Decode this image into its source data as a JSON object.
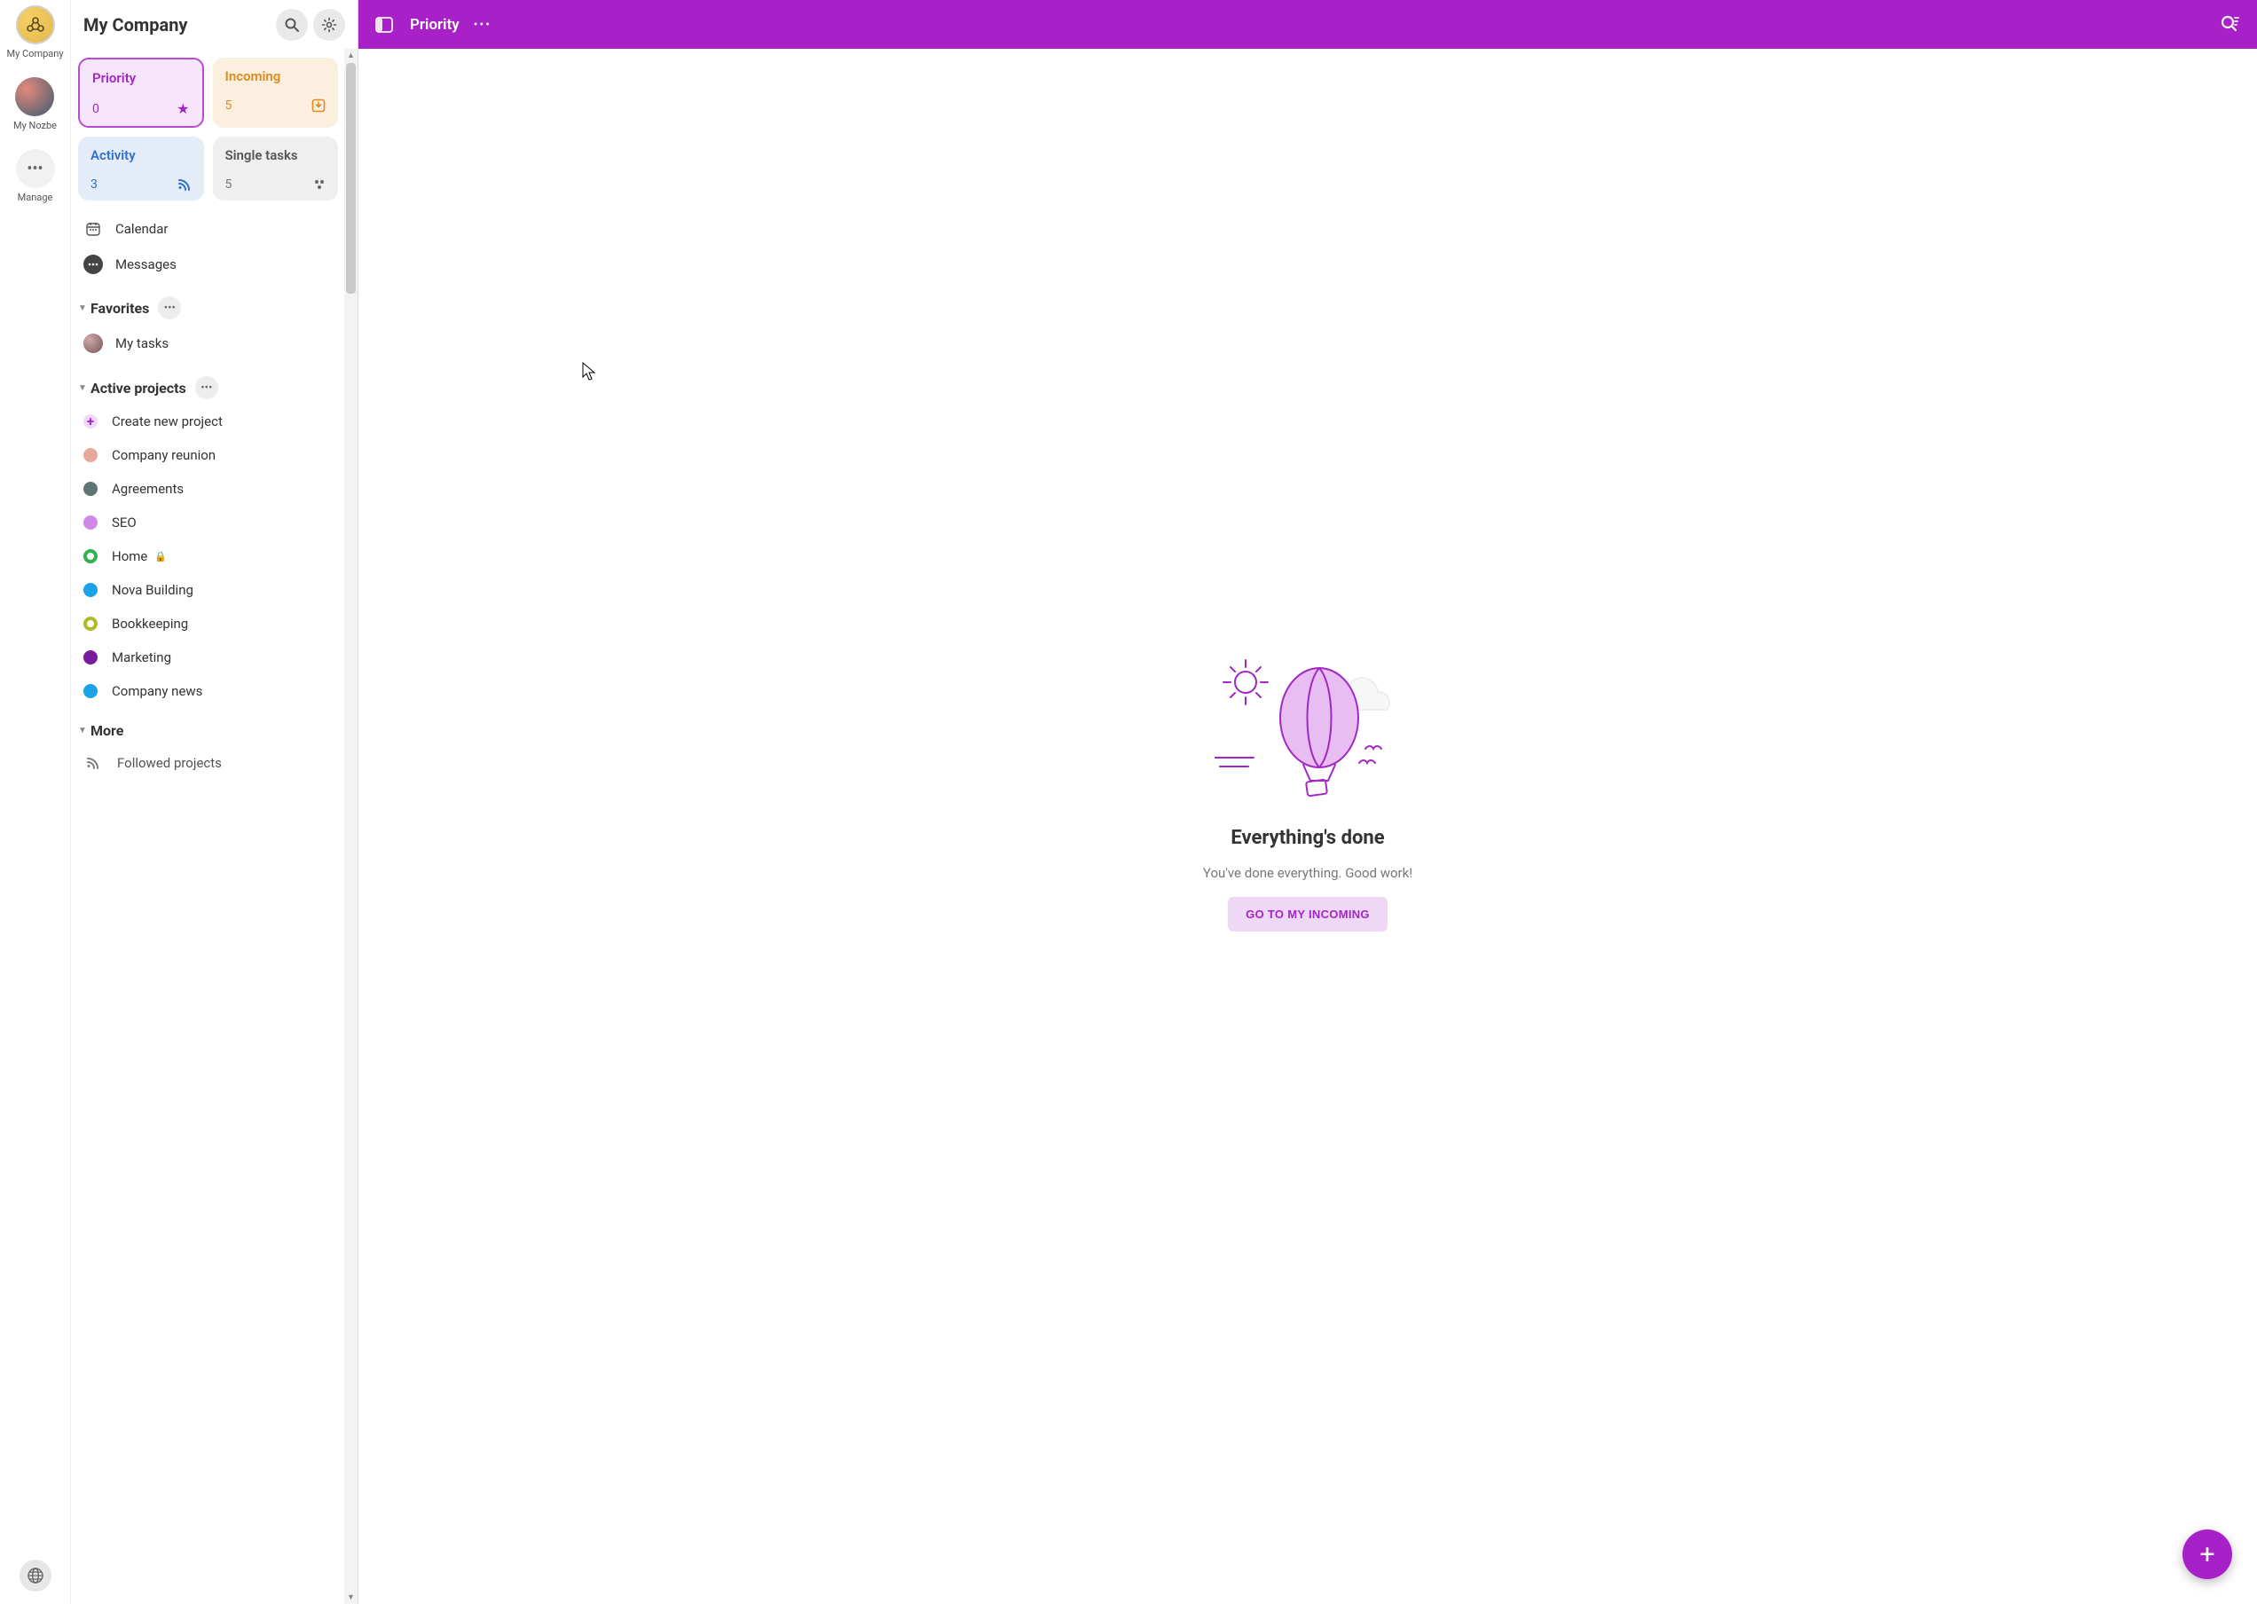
{
  "rail": {
    "items": [
      {
        "label": "My Company"
      },
      {
        "label": "My Nozbe"
      },
      {
        "label": "Manage"
      }
    ]
  },
  "sidebar": {
    "title": "My Company",
    "tiles": {
      "priority": {
        "title": "Priority",
        "count": "0"
      },
      "incoming": {
        "title": "Incoming",
        "count": "5"
      },
      "activity": {
        "title": "Activity",
        "count": "3"
      },
      "single": {
        "title": "Single tasks",
        "count": "5"
      }
    },
    "nav": {
      "calendar": "Calendar",
      "messages": "Messages"
    },
    "favorites": {
      "title": "Favorites",
      "items": [
        {
          "label": "My tasks"
        }
      ]
    },
    "active_projects": {
      "title": "Active projects",
      "create_label": "Create new project",
      "items": [
        {
          "label": "Company reunion",
          "color": "#e9a99a"
        },
        {
          "label": "Agreements",
          "color": "#5f7576"
        },
        {
          "label": "SEO",
          "color": "#cf8ae6"
        },
        {
          "label": "Home",
          "color": "#2fb34a",
          "ring": true,
          "locked": true
        },
        {
          "label": "Nova Building",
          "color": "#1aa3e8"
        },
        {
          "label": "Bookkeeping",
          "color": "#b1b82a",
          "ring": true
        },
        {
          "label": "Marketing",
          "color": "#7a1a9e"
        },
        {
          "label": "Company news",
          "color": "#1aa3e8"
        }
      ]
    },
    "more": {
      "title": "More",
      "followed": "Followed projects"
    }
  },
  "topbar": {
    "title": "Priority"
  },
  "empty": {
    "title": "Everything's done",
    "subtitle": "You've done everything. Good work!",
    "cta": "GO TO MY INCOMING"
  },
  "colors": {
    "brand": "#a820c8"
  }
}
